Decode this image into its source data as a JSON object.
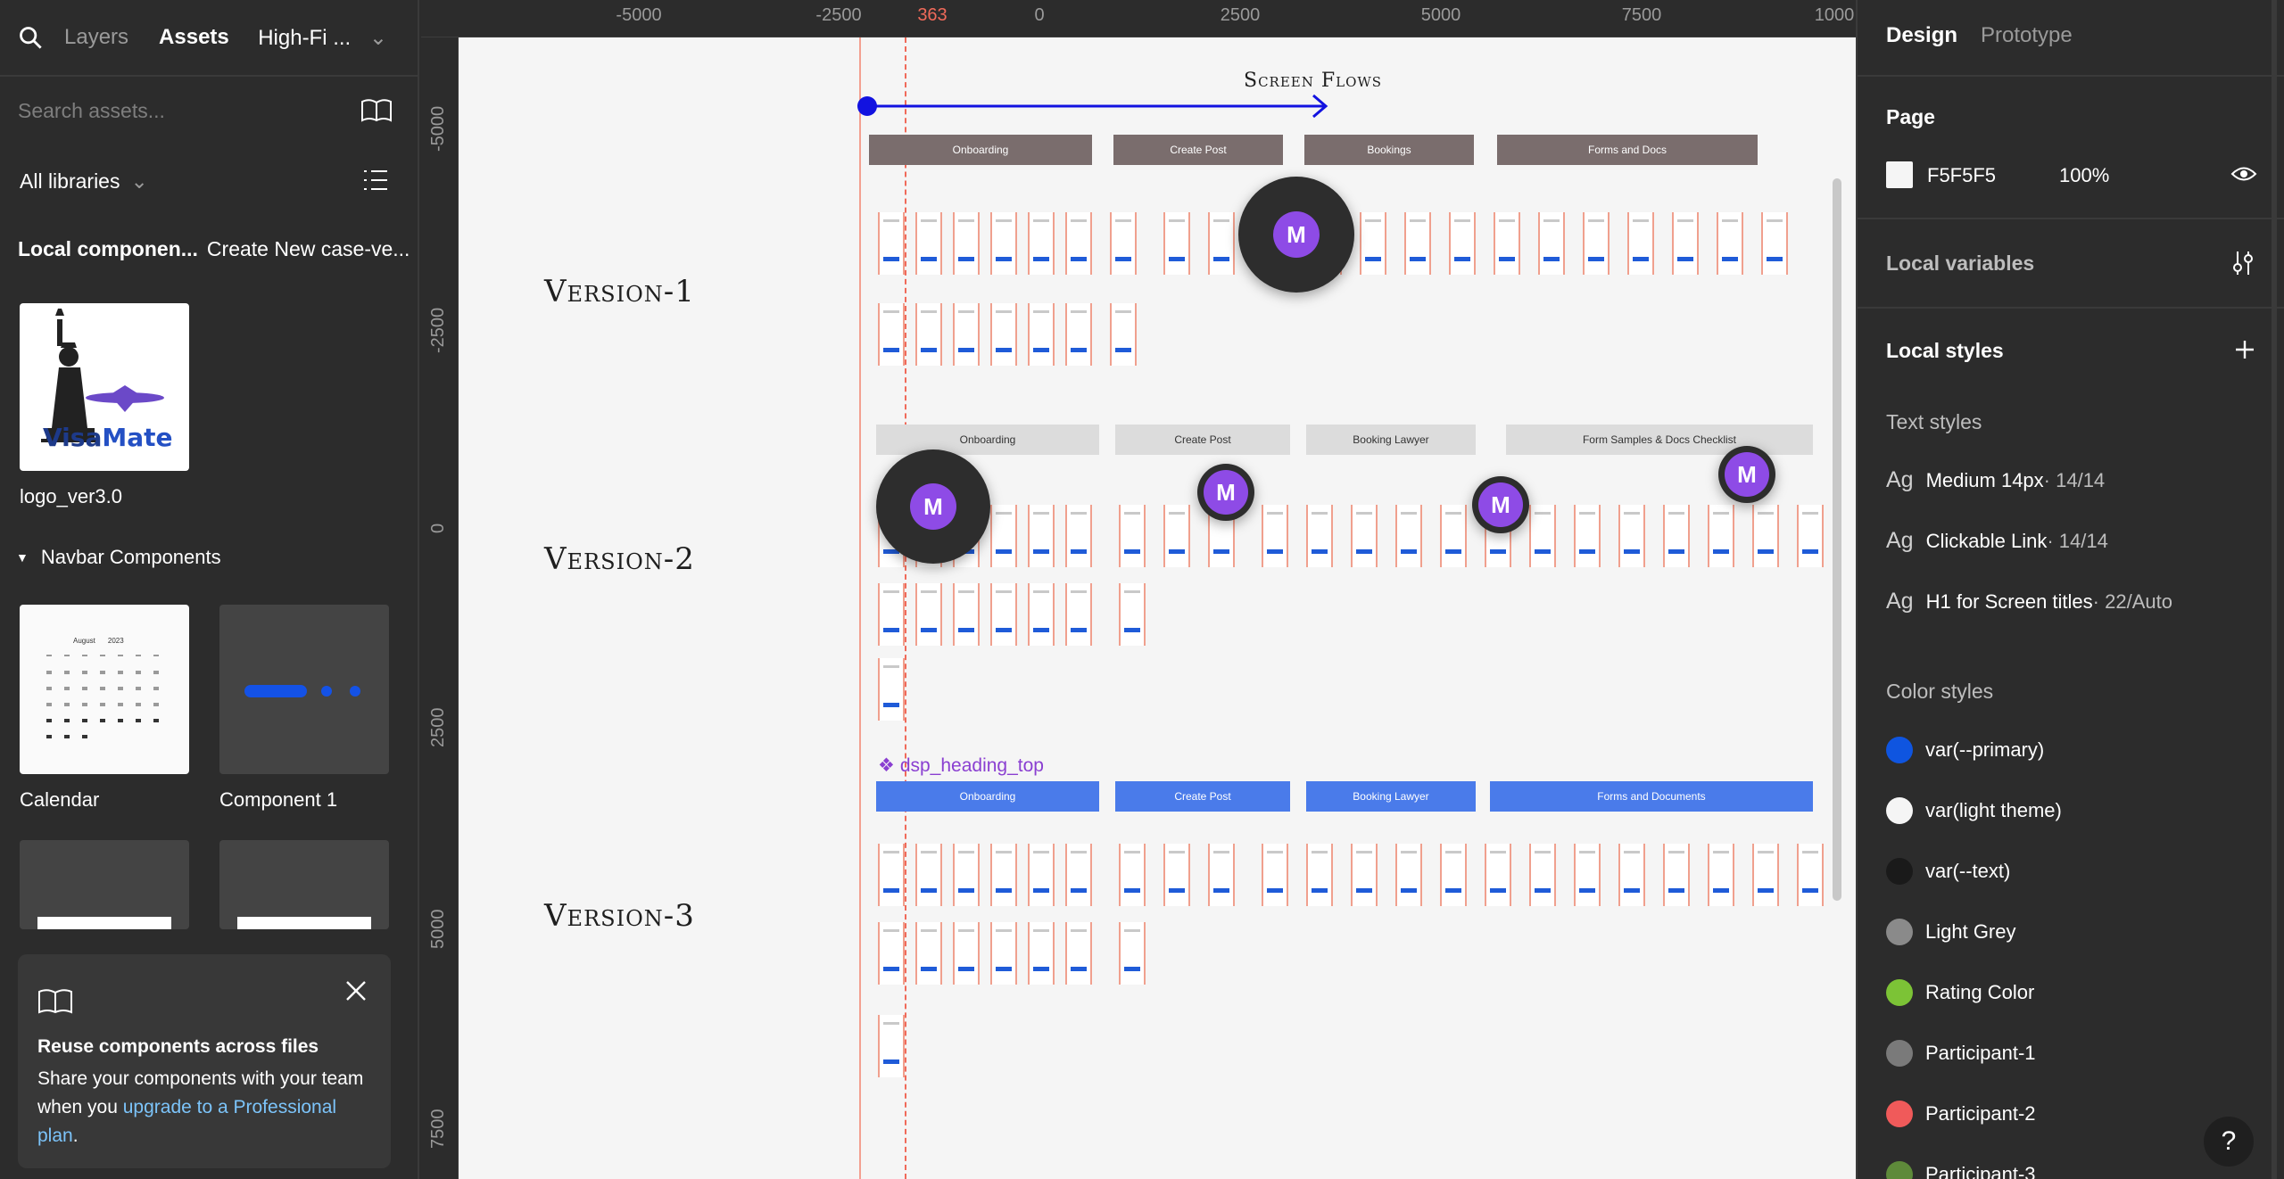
{
  "left": {
    "tabs": [
      "Layers",
      "Assets"
    ],
    "page_selector": "High-Fi ...",
    "search_placeholder": "Search assets...",
    "libraries": "All libraries",
    "local_components": "Local componen...",
    "local_components_right": "Create New case-ve...",
    "logo": {
      "label": "logo_ver3.0",
      "brand_text_1": "Visa",
      "brand_text_2": "Mate"
    },
    "navbar_section": "Navbar Components",
    "components": [
      "Calendar",
      "Component 1"
    ],
    "calendar_header": {
      "month": "August",
      "year": "2023"
    },
    "card": {
      "title": "Reuse components across files",
      "body": "Share your components with your team when you ",
      "link": "upgrade to a Professional plan",
      "end": "."
    }
  },
  "ruler": {
    "top": [
      "-5000",
      "-2500",
      "363",
      "0",
      "2500",
      "5000",
      "7500",
      "1000"
    ],
    "left": [
      "-5000",
      "-2500",
      "0",
      "2500",
      "5000",
      "7500"
    ]
  },
  "canvas": {
    "flow_title": "Screen Flows",
    "versions": [
      "Version-1",
      "Version-2",
      "Version-3"
    ],
    "v1_sections": [
      "Onboarding",
      "Create Post",
      "Bookings",
      "Forms and Docs"
    ],
    "v2_sections": [
      "Onboarding",
      "Create Post",
      "Booking Lawyer",
      "Form Samples & Docs Checklist"
    ],
    "v3_sections": [
      "Onboarding",
      "Create Post",
      "Booking Lawyer",
      "Forms and Documents"
    ],
    "component_tag": "dsp_heading_top",
    "avatar_initial": "M"
  },
  "right": {
    "tabs": [
      "Design",
      "Prototype"
    ],
    "page_label": "Page",
    "page_color": "F5F5F5",
    "page_opacity": "100%",
    "local_variables": "Local variables",
    "local_styles": "Local styles",
    "text_styles_label": "Text styles",
    "text_styles": [
      {
        "name": "Medium 14px",
        "meta": " · 14/14"
      },
      {
        "name": "Clickable Link",
        "meta": " · 14/14"
      },
      {
        "name": "H1 for Screen titles",
        "meta": " · 22/Auto"
      }
    ],
    "color_styles_label": "Color styles",
    "color_styles": [
      {
        "name": "var(--primary)",
        "color": "#0f55e0"
      },
      {
        "name": "var(light theme)",
        "color": "#f5f5f5"
      },
      {
        "name": "var(--text)",
        "color": "#1a1a1a"
      },
      {
        "name": "Light Grey",
        "color": "#8a8a8a"
      },
      {
        "name": "Rating Color",
        "color": "#7cc336"
      },
      {
        "name": "Participant-1",
        "color": "#7a7a7a"
      },
      {
        "name": "Participant-2",
        "color": "#f05a5a"
      },
      {
        "name": "Participant-3",
        "color": "#5e8a3a"
      }
    ]
  }
}
